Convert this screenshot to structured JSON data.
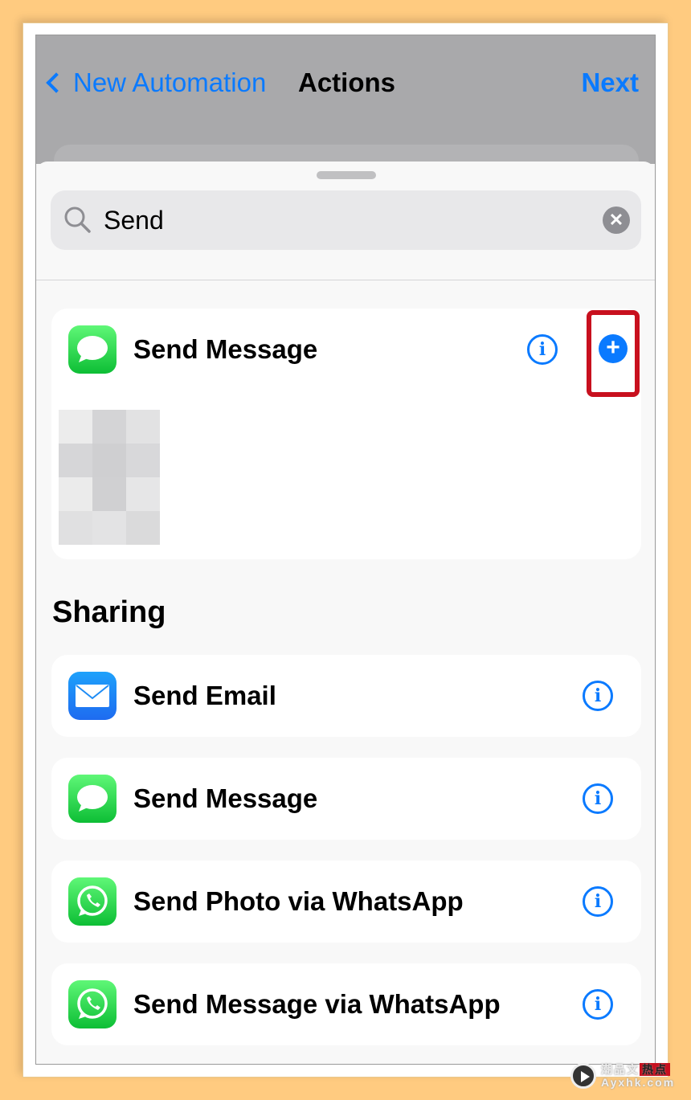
{
  "nav": {
    "back_label": "New Automation",
    "title": "Actions",
    "next_label": "Next"
  },
  "search": {
    "value": "Send"
  },
  "top_result": {
    "label": "Send Message",
    "icon": "messages-icon"
  },
  "section": {
    "title": "Sharing",
    "items": [
      {
        "label": "Send Email",
        "icon": "mail-icon"
      },
      {
        "label": "Send Message",
        "icon": "messages-icon"
      },
      {
        "label": "Send Photo via WhatsApp",
        "icon": "whatsapp-icon"
      },
      {
        "label": "Send Message via WhatsApp",
        "icon": "whatsapp-icon"
      }
    ]
  },
  "colors": {
    "accent": "#0A7AFF",
    "highlight": "#C8101E",
    "background": "#FFCB80"
  },
  "watermark": {
    "brand": "潮品文",
    "tag": "热点",
    "site": "Ayxhk.com"
  }
}
